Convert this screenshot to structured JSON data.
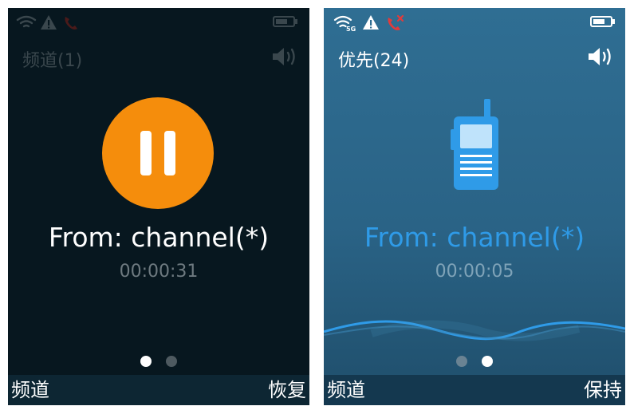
{
  "left": {
    "status_icons": [
      "wifi-icon",
      "warning-icon",
      "missed-call-icon",
      "battery-icon"
    ],
    "channel_title": "频道(1)",
    "speaker_icon": "speaker-icon",
    "action_icon": "pause-icon",
    "from_text": "From: channel(*)",
    "timer": "00:00:31",
    "page_index": {
      "active": 1,
      "total": 2
    },
    "softkey_left": "频道",
    "softkey_right": "恢复",
    "colors": {
      "background": "#07171f",
      "accent": "#f58d0c",
      "softbar": "#0d2633"
    }
  },
  "right": {
    "status_icons": [
      "wifi-5g-icon",
      "warning-icon",
      "missed-call-icon",
      "battery-icon"
    ],
    "wifi_badge": "5G",
    "channel_title": "优先(24)",
    "speaker_icon": "speaker-icon",
    "action_icon": "walkie-talkie-icon",
    "from_text": "From: channel(*)",
    "timer": "00:00:05",
    "page_index": {
      "active": 2,
      "total": 2
    },
    "softkey_left": "频道",
    "softkey_right": "保持",
    "colors": {
      "background": "#2a6386",
      "accent": "#2f9be8",
      "softbar": "#14384f"
    }
  }
}
